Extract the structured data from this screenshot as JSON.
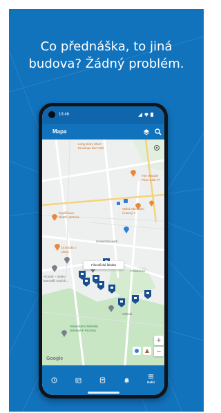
{
  "promo": {
    "line1": "Co přednáška, to jiná",
    "line2": "budova? Žádný problém."
  },
  "statusbar": {
    "time": "13:46",
    "icons": [
      "signal-icon",
      "wifi-icon",
      "battery-icon"
    ]
  },
  "appbar": {
    "title": "Mapa",
    "actions": [
      "layers-icon",
      "search-icon"
    ]
  },
  "map": {
    "labels": {
      "cafe": "Long Story Short\nEnvelope Bar Café",
      "hotel": "The Wander\nPlum Club Pl",
      "spoljordan": "Špalíčkova\nNámě. pizzerie",
      "velka": "Velká Obchodní\nÚnavný 1",
      "univ": "Univerzitní park",
      "teatr": "DoStudio z\nplacu",
      "marriott": "RCSoft – Výuko\nkancelář nových...",
      "reach": "Přiměřená",
      "garden": "Sekundární Zahrady\nčervených Pizzeria",
      "oblouk": "Oblouk"
    },
    "callout": "Filozofická fakulta",
    "google": "Google",
    "zoom_in": "+",
    "zoom_out": "−",
    "colors": {
      "park": "#c8e6c4",
      "road": "#ffffff",
      "marker": "#1a4f8f",
      "poi": "#e8873d"
    }
  },
  "nav": {
    "items": [
      {
        "icon": "clock-icon",
        "label": ""
      },
      {
        "icon": "calendar-icon",
        "label": ""
      },
      {
        "icon": "document-icon",
        "label": ""
      },
      {
        "icon": "bell-icon",
        "label": ""
      },
      {
        "icon": "menu-icon",
        "label": "Další"
      }
    ]
  }
}
